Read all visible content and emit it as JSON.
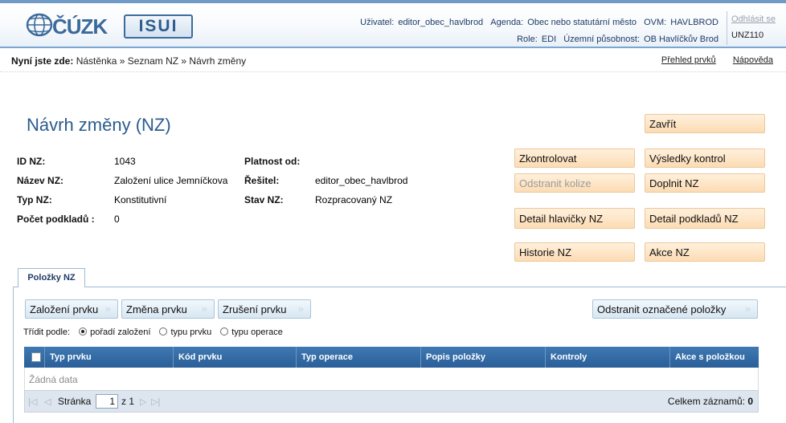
{
  "header": {
    "logo_cuzk": "ČÚZK",
    "logo_isui": "ISUI",
    "user_label": "Uživatel:",
    "user": "editor_obec_havlbrod",
    "agenda_label": "Agenda:",
    "agenda": "Obec nebo statutární město",
    "ovm_label": "OVM:",
    "ovm": "HAVLBROD",
    "role_label": "Role:",
    "role": "EDI",
    "territory_label": "Územní působnost:",
    "territory": "OB Havlíčkův Brod",
    "logout": "Odhlásit se",
    "code": "UNZ110"
  },
  "breadcrumb": {
    "prefix": "Nyní jste zde:",
    "path": "Nástěnka » Seznam NZ » Návrh změny",
    "link_overview": "Přehled prvků",
    "link_help": "Nápověda"
  },
  "title": "Návrh změny (NZ)",
  "info": {
    "id_label": "ID NZ:",
    "id": "1043",
    "name_label": "Název NZ:",
    "name": "Založení ulice Jemníčkova",
    "type_label": "Typ NZ:",
    "type": "Konstitutivní",
    "docs_label": "Počet podkladů :",
    "docs": "0",
    "valid_label": "Platnost od:",
    "valid": "",
    "solver_label": "Řešitel:",
    "solver": "editor_obec_havlbrod",
    "state_label": "Stav NZ:",
    "state": "Rozpracovaný NZ"
  },
  "actions": {
    "close": "Zavřít",
    "check": "Zkontrolovat",
    "check_results": "Výsledky kontrol",
    "remove_collisions": "Odstranit kolize",
    "complete": "Doplnit NZ",
    "header_detail": "Detail hlavičky NZ",
    "docs_detail": "Detail podkladů NZ",
    "history": "Historie NZ",
    "actions": "Akce NZ"
  },
  "tab": {
    "label": "Položky NZ"
  },
  "item_buttons": {
    "create": "Založení prvku",
    "change": "Změna prvku",
    "cancel": "Zrušení prvku",
    "remove_selected": "Odstranit označené položky"
  },
  "sort": {
    "label": "Třídit podle:",
    "options": [
      "pořadí založení",
      "typu prvku",
      "typu operace"
    ],
    "selected": "pořadí založení"
  },
  "grid": {
    "columns": [
      "Typ prvku",
      "Kód prvku",
      "Typ operace",
      "Popis položky",
      "Kontroly",
      "Akce s položkou"
    ],
    "empty": "Žádná data"
  },
  "pager": {
    "page_label": "Stránka",
    "page": "1",
    "of": "z 1",
    "total_label": "Celkem záznamů:",
    "total": "0"
  }
}
